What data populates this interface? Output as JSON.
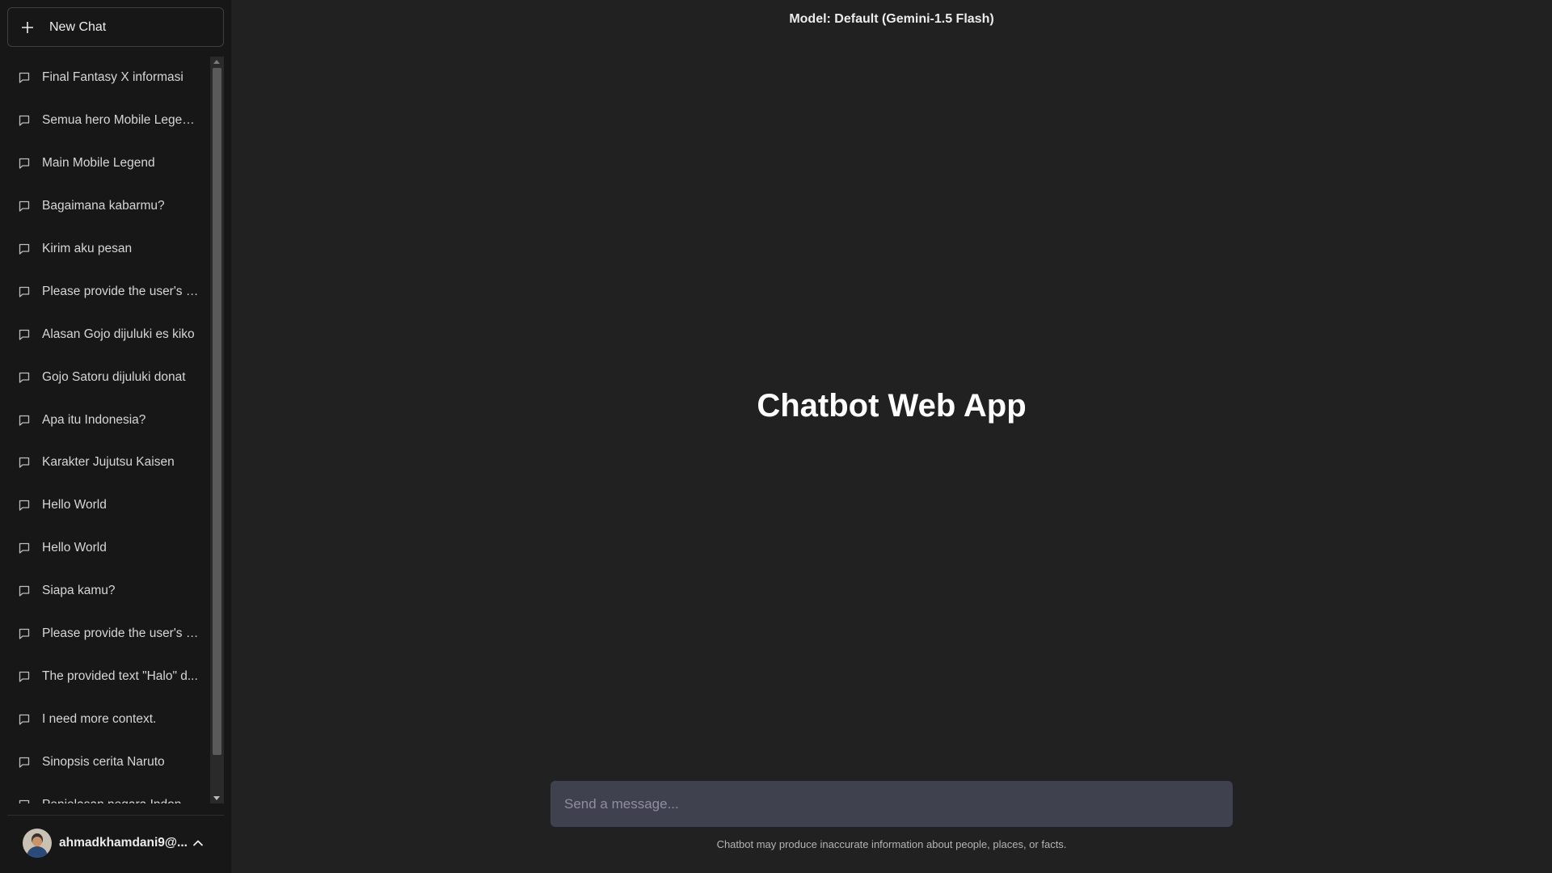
{
  "sidebar": {
    "new_chat_label": "New Chat",
    "history": [
      {
        "title": "Final Fantasy X informasi"
      },
      {
        "title": "Semua hero Mobile Legends"
      },
      {
        "title": "Main Mobile Legend"
      },
      {
        "title": "Bagaimana kabarmu?"
      },
      {
        "title": "Kirim aku pesan"
      },
      {
        "title": "Please provide the user's c..."
      },
      {
        "title": "Alasan Gojo dijuluki es kiko"
      },
      {
        "title": "Gojo Satoru dijuluki donat"
      },
      {
        "title": "Apa itu Indonesia?"
      },
      {
        "title": "Karakter Jujutsu Kaisen"
      },
      {
        "title": "Hello World"
      },
      {
        "title": "Hello World"
      },
      {
        "title": "Siapa kamu?"
      },
      {
        "title": "Please provide the user's c..."
      },
      {
        "title": "The provided text \"Halo\" d..."
      },
      {
        "title": "I need more context."
      },
      {
        "title": "Sinopsis cerita Naruto"
      },
      {
        "title": "Penjelasan negara Indonesia"
      }
    ],
    "user": {
      "name": "ahmadkhamdani9@..."
    }
  },
  "main": {
    "model_label": "Model: Default (Gemini-1.5 Flash)",
    "title": "Chatbot Web App",
    "composer": {
      "placeholder": "Send a message...",
      "value": ""
    },
    "disclaimer": "Chatbot may produce inaccurate information about people, places, or facts."
  },
  "colors": {
    "main_bg": "#212121",
    "sidebar_bg": "#171717",
    "input_bg": "#40414f"
  }
}
